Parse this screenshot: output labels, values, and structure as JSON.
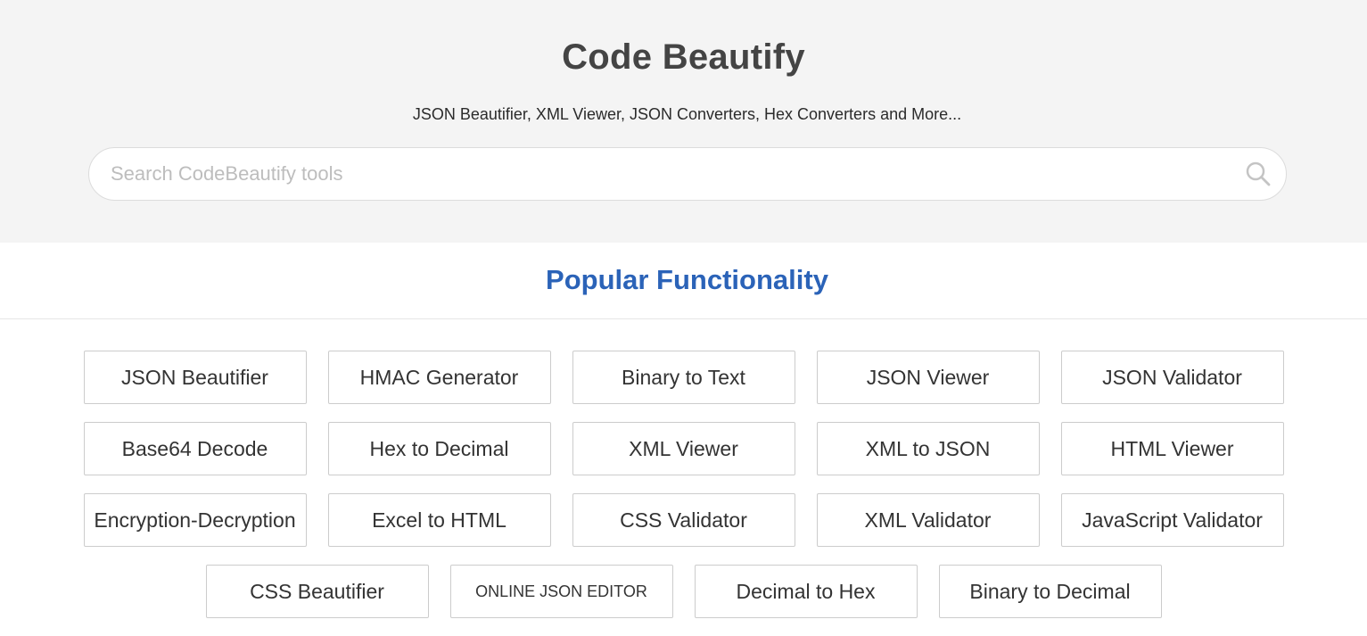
{
  "header": {
    "title": "Code Beautify",
    "subtitle": "JSON Beautifier, XML Viewer, JSON Converters, Hex Converters and More..."
  },
  "search": {
    "placeholder": "Search CodeBeautify tools",
    "value": "",
    "icon": "search-icon"
  },
  "popular": {
    "title": "Popular Functionality",
    "rows": [
      [
        "JSON Beautifier",
        "HMAC Generator",
        "Binary to Text",
        "JSON Viewer",
        "JSON Validator"
      ],
      [
        "Base64 Decode",
        "Hex to Decimal",
        "XML Viewer",
        "XML to JSON",
        "HTML Viewer"
      ],
      [
        "Encryption-Decryption",
        "Excel to HTML",
        "CSS Validator",
        "XML Validator",
        "JavaScript Validator"
      ],
      [
        "CSS Beautifier",
        "ONLINE JSON EDITOR",
        "Decimal to Hex",
        "Binary to Decimal"
      ]
    ]
  },
  "colors": {
    "hero_background": "#f4f4f4",
    "section_title": "#2b63b8",
    "site_title": "#444444"
  }
}
